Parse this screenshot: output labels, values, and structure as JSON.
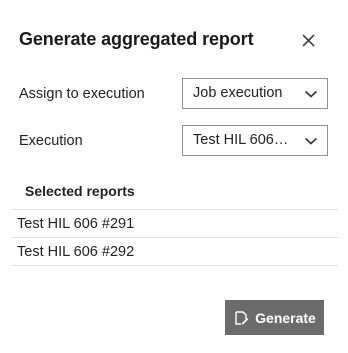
{
  "dialog": {
    "title": "Generate aggregated report",
    "close_icon": "close-icon"
  },
  "form": {
    "assign_label": "Assign to execution",
    "assign_value": "Job execution",
    "execution_label": "Execution",
    "execution_value": "Test HIL 606…"
  },
  "reports": {
    "header": "Selected reports",
    "items": [
      "Test HIL 606 #291",
      "Test HIL 606 #292"
    ]
  },
  "actions": {
    "generate_label": "Generate",
    "generate_icon": "report-sign-icon"
  },
  "colors": {
    "button_bg": "#6b6b6b",
    "border": "#8f8f8f"
  }
}
